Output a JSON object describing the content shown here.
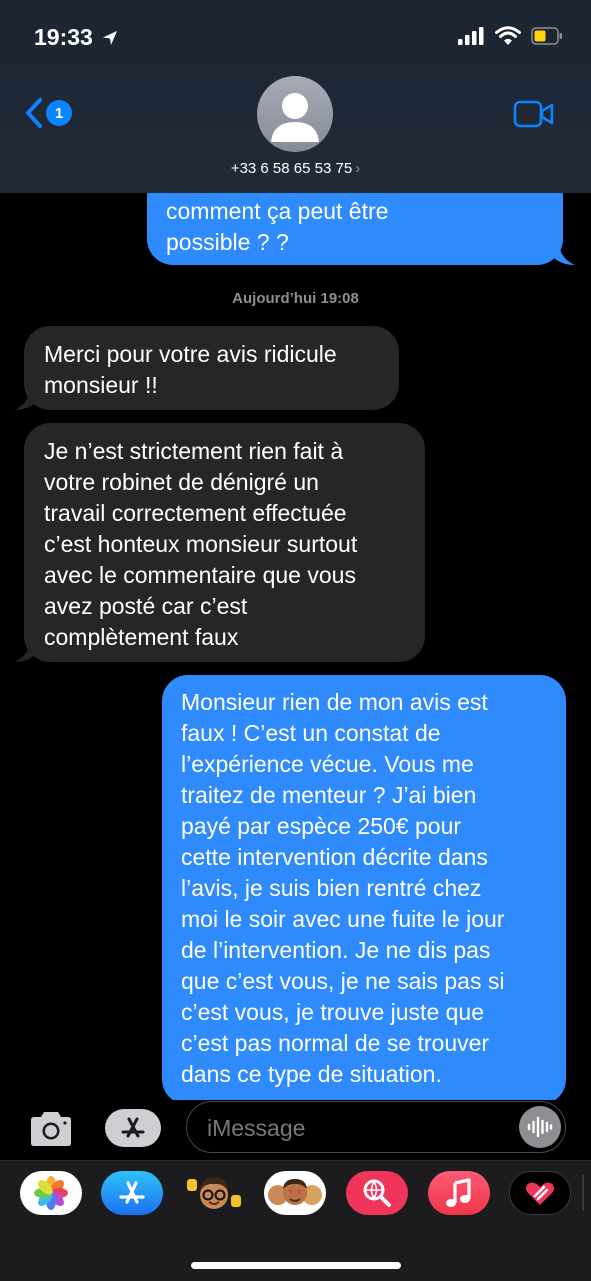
{
  "status_bar": {
    "time": "19:33"
  },
  "header": {
    "back_badge": "1",
    "contact": "+33 6 58 65 53 75",
    "contact_chevron": "›"
  },
  "messages": [
    {
      "direction": "out",
      "lines": [
        "comment ça peut être",
        "possible ? ?"
      ]
    },
    {
      "direction": "in",
      "lines": [
        "Merci pour votre avis ridicule",
        "monsieur !!"
      ]
    },
    {
      "direction": "in",
      "lines": [
        "Je n’est strictement rien fait à",
        "votre robinet de dénigré un",
        "travail correctement effectuée",
        "c’est honteux monsieur surtout",
        "avec le commentaire que vous",
        "avez posté car c’est",
        "complètement faux"
      ]
    },
    {
      "direction": "out",
      "lines": [
        "Monsieur rien de mon avis est",
        "faux ! C’est un constat de",
        "l’expérience vécue. Vous me",
        "traitez de menteur ? J’ai bien",
        "payé par espèce 250€ pour",
        "cette intervention décrite dans",
        "l’avis, je suis bien rentré chez",
        "moi le soir avec une fuite le jour",
        "de l’intervention. Je ne dis pas",
        "que c’est vous, je ne sais pas si",
        "c’est vous, je trouve juste que",
        "c’est pas normal de se trouver",
        "dans ce type de situation."
      ]
    }
  ],
  "timestamp": "Aujourd’hui 19:08",
  "input": {
    "placeholder": "iMessage",
    "value": ""
  },
  "app_drawer": [
    {
      "name": "photos-app-icon"
    },
    {
      "name": "app-store-app-icon"
    },
    {
      "name": "memoji-app-icon"
    },
    {
      "name": "memoji-stickers-app-icon"
    },
    {
      "name": "images-search-app-icon"
    },
    {
      "name": "music-app-icon"
    },
    {
      "name": "digital-touch-app-icon"
    }
  ],
  "colors": {
    "outgoing": "#2f8afb",
    "incoming": "#262628",
    "accent": "#0a84ff"
  }
}
